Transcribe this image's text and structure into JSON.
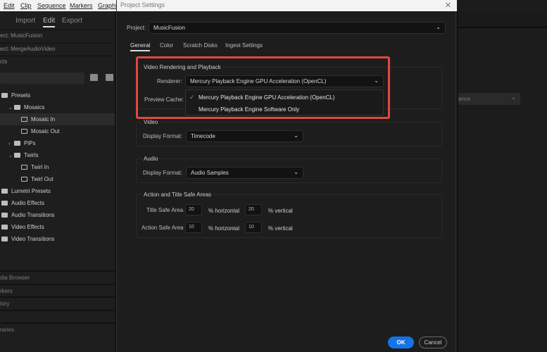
{
  "menubar": {
    "items": [
      "Edit",
      "Clip",
      "Sequence",
      "Markers",
      "Graphi"
    ]
  },
  "workspace_tabs": [
    "Import",
    "Edit",
    "Export"
  ],
  "left_panel": {
    "project_rows": [
      "ect: MusicFusion",
      "ect: MergeAudioVideo",
      "cts"
    ],
    "tree": [
      {
        "label": "Presets",
        "indent": 0,
        "icon": "preset-folder-icon",
        "chev": ""
      },
      {
        "label": "Mosaics",
        "indent": 1,
        "icon": "preset-folder-icon",
        "chev": "v"
      },
      {
        "label": "Mosaic In",
        "indent": 2,
        "icon": "preset-icon",
        "chev": "",
        "selected": true
      },
      {
        "label": "Mosaic Out",
        "indent": 2,
        "icon": "preset-icon",
        "chev": ""
      },
      {
        "label": "PiPs",
        "indent": 1,
        "icon": "preset-folder-icon",
        "chev": ">"
      },
      {
        "label": "Twirls",
        "indent": 1,
        "icon": "preset-folder-icon",
        "chev": "v"
      },
      {
        "label": "Twirl In",
        "indent": 2,
        "icon": "preset-icon",
        "chev": ""
      },
      {
        "label": "Twirl Out",
        "indent": 2,
        "icon": "preset-icon",
        "chev": ""
      },
      {
        "label": "Lumetri Presets",
        "indent": 0,
        "icon": "preset-folder-icon",
        "chev": ""
      },
      {
        "label": "Audio Effects",
        "indent": 0,
        "icon": "folder-icon",
        "chev": ""
      },
      {
        "label": "Audio Transitions",
        "indent": 0,
        "icon": "folder-icon",
        "chev": ""
      },
      {
        "label": "Video Effects",
        "indent": 0,
        "icon": "folder-icon",
        "chev": ""
      },
      {
        "label": "Video Transitions",
        "indent": 0,
        "icon": "folder-icon",
        "chev": ""
      }
    ],
    "lower_panels": [
      "dia Browser",
      "rkers",
      "tory",
      "",
      "raries"
    ]
  },
  "dialog": {
    "title": "Project Settings",
    "project_label": "Project:",
    "project_value": "MusicFusion",
    "tabs": [
      "General",
      "Color",
      "Scratch Disks",
      "Ingest Settings"
    ],
    "rendering": {
      "title": "Video Rendering and Playback",
      "renderer_label": "Renderer:",
      "renderer_value": "Mercury Playback Engine GPU Acceleration (OpenCL)",
      "preview_cache_label": "Preview Cache:",
      "options": [
        "Mercury Playback Engine GPU Acceleration (OpenCL)",
        "Mercury Playback Engine Software Only"
      ],
      "check": "✓"
    },
    "video": {
      "title": "Video",
      "display_format_label": "Display Format:",
      "display_format_value": "Timecode"
    },
    "audio": {
      "title": "Audio",
      "display_format_label": "Display Format:",
      "display_format_value": "Audio Samples"
    },
    "safe": {
      "title": "Action and Title Safe Areas",
      "title_safe_label": "Title Safe Area",
      "title_h": "20",
      "title_v": "20",
      "action_safe_label": "Action Safe Area",
      "action_h": "10",
      "action_v": "10",
      "h_unit": "% horizontal",
      "v_unit": "% vertical"
    },
    "ok": "OK",
    "cancel": "Cancel"
  },
  "right_panel": {
    "dropdown_value": "ance"
  },
  "colors": {
    "accent": "#1473e6",
    "highlight": "#e0483e"
  }
}
